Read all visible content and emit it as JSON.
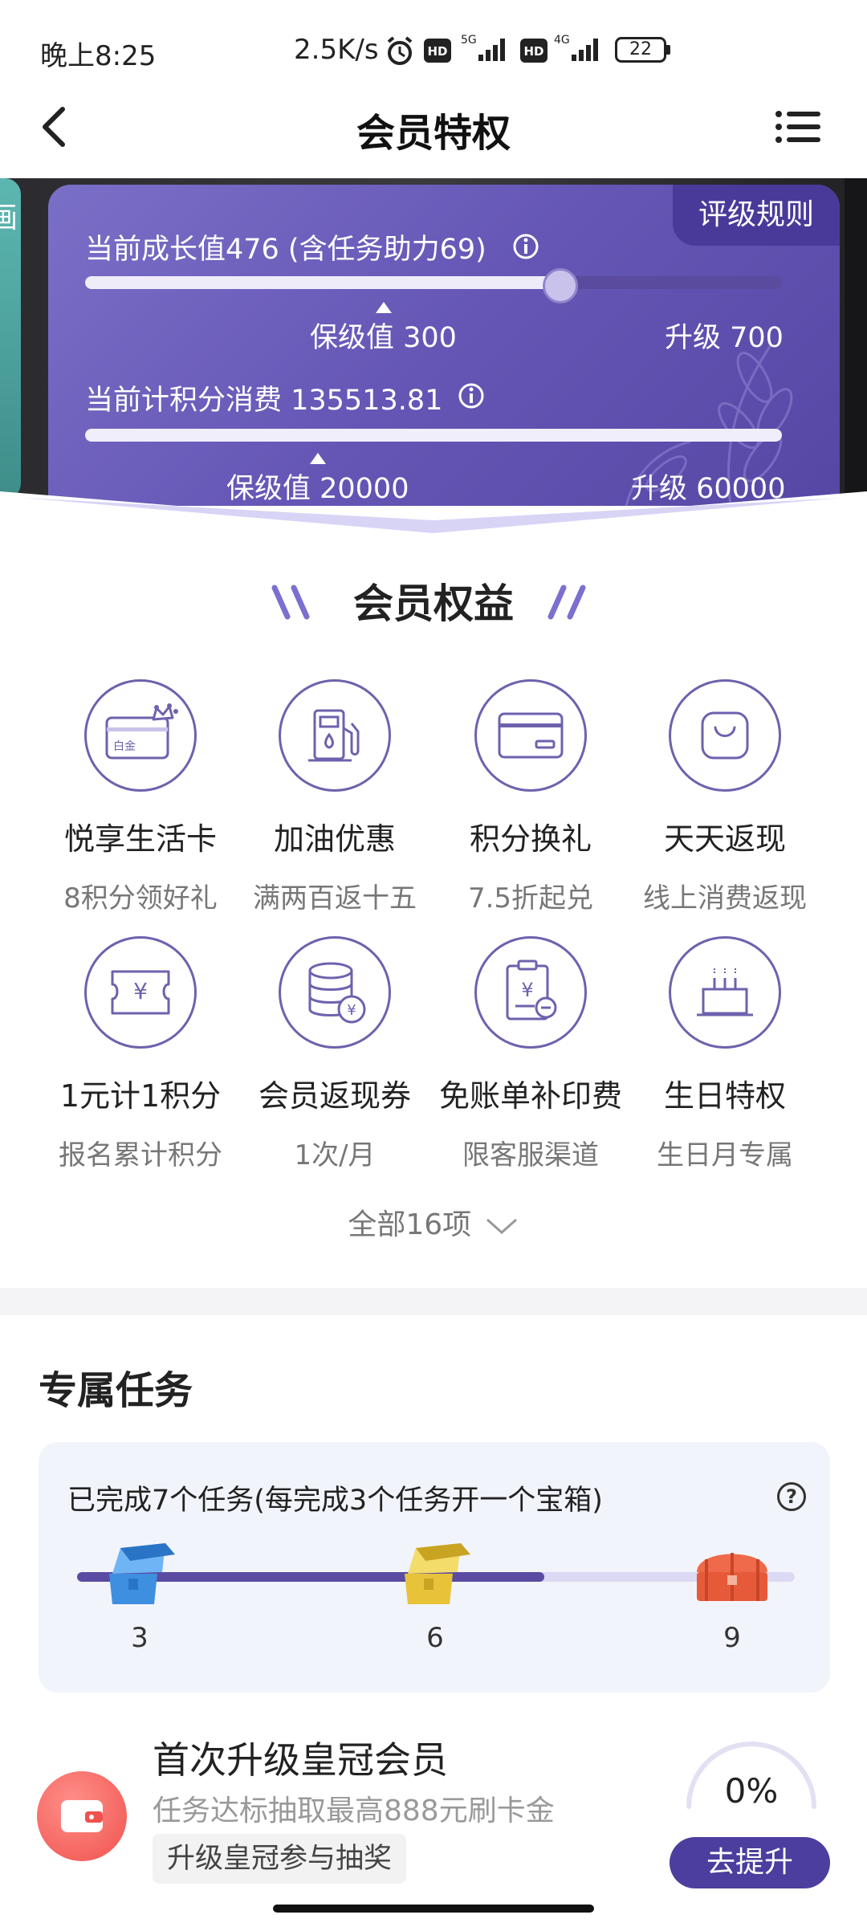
{
  "status_bar": {
    "time": "晚上8:25",
    "network_speed": "2.5K/s",
    "battery": "22",
    "icons": [
      "alarm-icon",
      "hd-icon",
      "5g-signal-icon",
      "hd-icon",
      "4g-signal-icon",
      "battery-icon"
    ]
  },
  "nav": {
    "title": "会员特权",
    "icons": [
      "back-arrow-icon",
      "menu-list-icon"
    ]
  },
  "banner": {
    "left_card_text": "画",
    "rules_button": "评级规则",
    "growth": {
      "label": "当前成长值476 (含任务助力69)",
      "value": 476,
      "keep_label": "保级值 300",
      "keep_value": 300,
      "upgrade_label": "升级 700",
      "upgrade_value": 700
    },
    "points": {
      "label": "当前计积分消费 135513.81",
      "value": 135513.81,
      "keep_label": "保级值 20000",
      "keep_value": 20000,
      "upgrade_label": "升级 60000",
      "upgrade_value": 60000
    }
  },
  "benefits": {
    "title": "会员权益",
    "items": [
      {
        "name": "悦享生活卡",
        "sub": "8积分领好礼",
        "icon": "platinum-card-icon",
        "card_text": "白金"
      },
      {
        "name": "加油优惠",
        "sub": "满两百返十五",
        "icon": "fuel-pump-icon"
      },
      {
        "name": "积分换礼",
        "sub": "7.5折起兑",
        "icon": "card-gift-icon"
      },
      {
        "name": "天天返现",
        "sub": "线上消费返现",
        "icon": "shopping-bag-icon"
      },
      {
        "name": "1元计1积分",
        "sub": "报名累计积分",
        "icon": "yuan-ticket-icon"
      },
      {
        "name": "会员返现券",
        "sub": "1次/月",
        "icon": "coin-stack-icon"
      },
      {
        "name": "免账单补印费",
        "sub": "限客服渠道",
        "icon": "bill-clipboard-icon"
      },
      {
        "name": "生日特权",
        "sub": "生日月专属",
        "icon": "birthday-cake-icon"
      }
    ],
    "show_all": "全部16项"
  },
  "tasks": {
    "title": "专属任务",
    "description": "已完成7个任务(每完成3个任务开一个宝箱)",
    "completed": 7,
    "milestones": [
      {
        "label": "3",
        "color": "#3f8fe0"
      },
      {
        "label": "6",
        "color": "#e8c33a"
      },
      {
        "label": "9",
        "color": "#ee6a4a"
      }
    ]
  },
  "promo": {
    "title": "首次升级皇冠会员",
    "subtitle": "任务达标抽取最高888元刷卡金",
    "tag": "升级皇冠参与抽奖",
    "percent": "0%",
    "button": "去提升"
  },
  "colors": {
    "accent": "#4b3e9e",
    "card_purple": "#6556b5",
    "icon_stroke": "#6d62ad"
  }
}
